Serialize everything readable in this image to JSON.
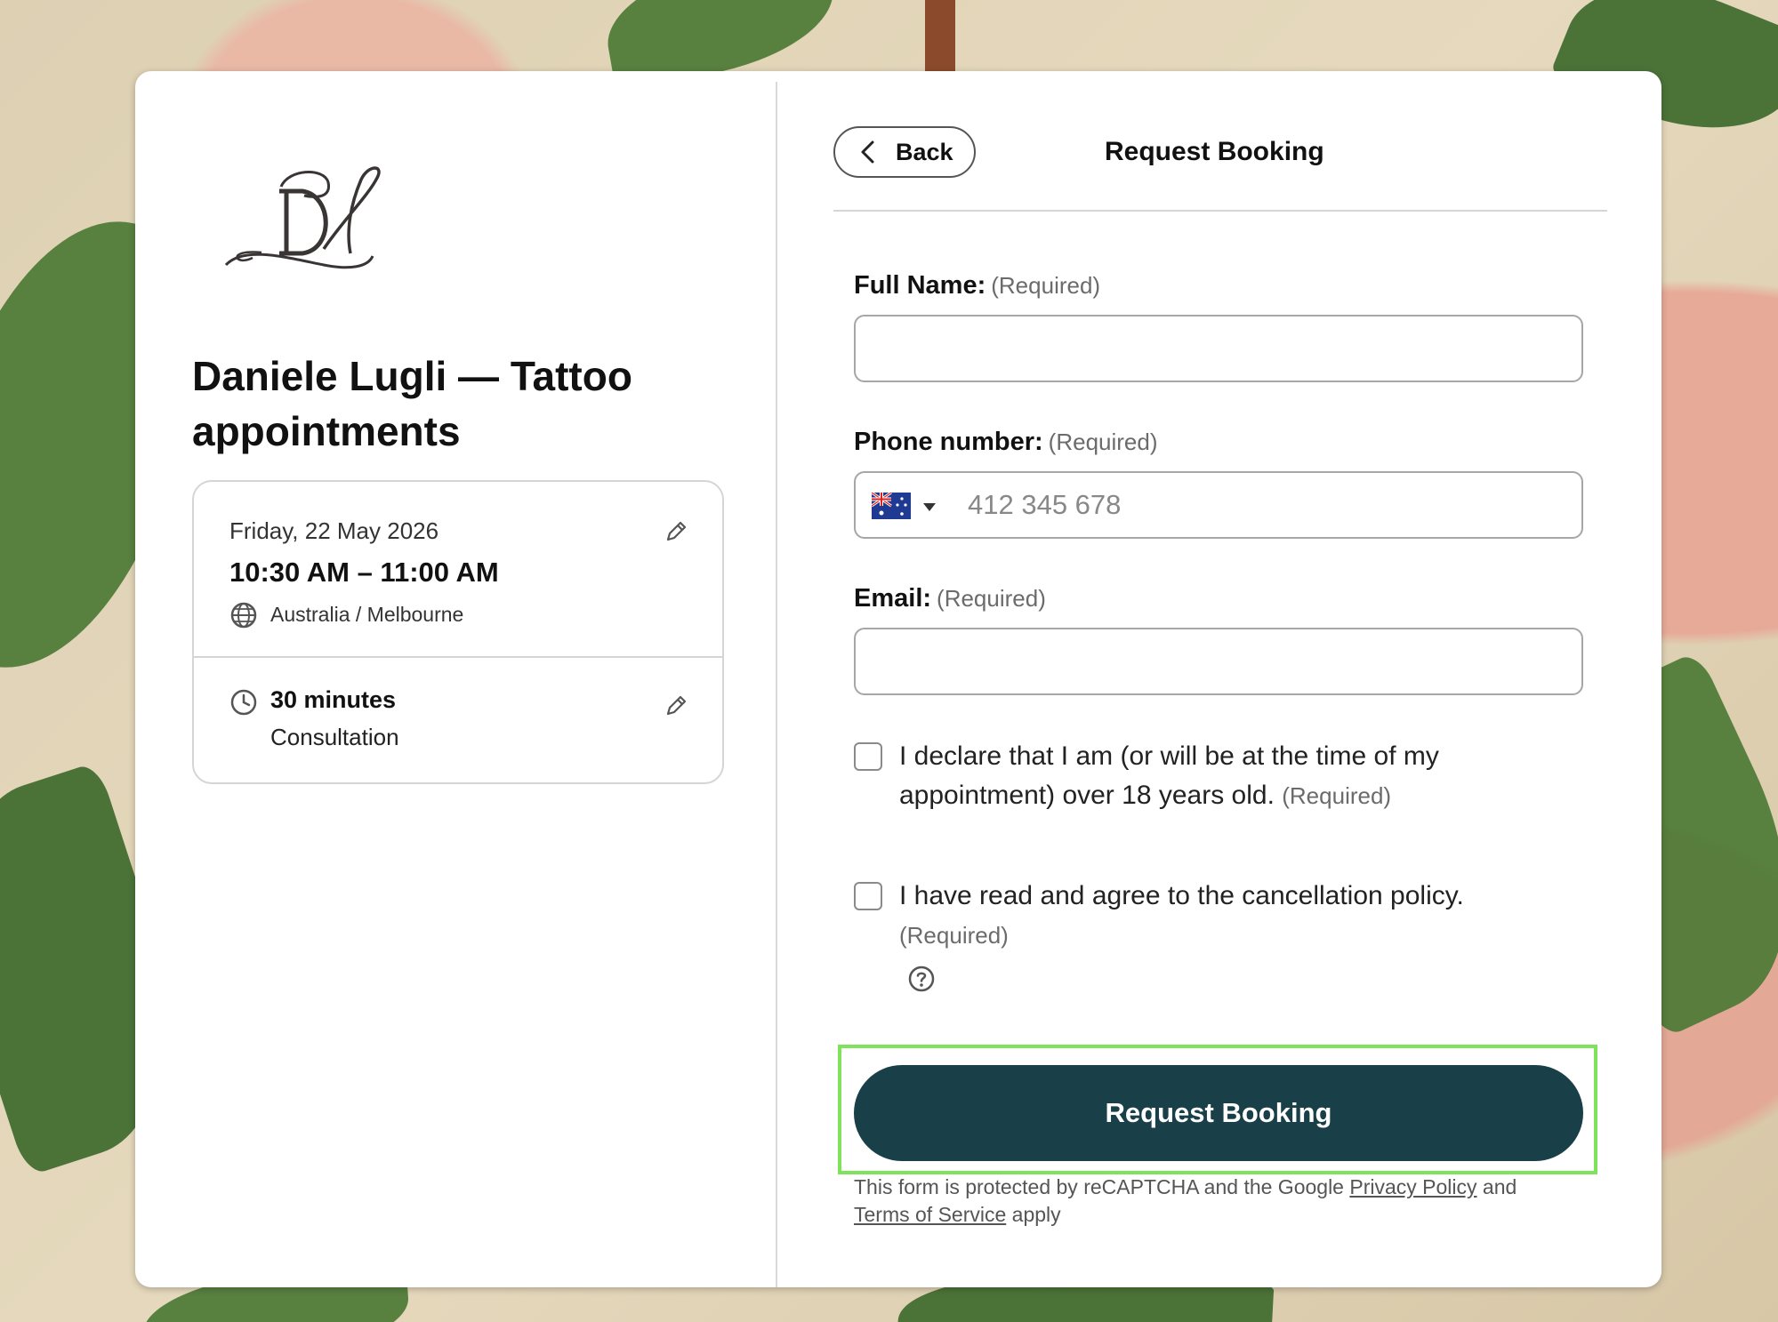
{
  "business": {
    "logo_monogram": "DL",
    "title": "Daniele Lugli — Tattoo appointments"
  },
  "summary": {
    "date": "Friday, 22 May 2026",
    "time_range": "10:30 AM – 11:00 AM",
    "timezone": "Australia / Melbourne",
    "duration": "30 minutes",
    "service": "Consultation"
  },
  "header": {
    "back_label": "Back",
    "title": "Request Booking"
  },
  "form": {
    "full_name_label": "Full Name:",
    "full_name_required": "(Required)",
    "full_name_value": "",
    "phone_label": "Phone number:",
    "phone_required": "(Required)",
    "phone_country": "AU",
    "phone_placeholder": "412 345 678",
    "email_label": "Email:",
    "email_required": "(Required)",
    "email_value": "",
    "age_text_line1": "I declare that I am (or will be at the time of my",
    "age_text_line2": "appointment) over 18 years old.",
    "age_required": "(Required)",
    "age_checked": false,
    "policy_text": "I have read and agree to the cancellation policy.",
    "policy_required": "(Required)",
    "policy_checked": false,
    "submit_label": "Request Booking"
  },
  "legal": {
    "prefix": "This form is protected by reCAPTCHA and the Google",
    "privacy_link": "Privacy Policy",
    "and": "and",
    "terms_link": "Terms of Service",
    "suffix": "apply"
  },
  "icons": {
    "edit": "pencil-icon",
    "timezone": "globe-icon",
    "duration": "clock-icon",
    "back": "chevron-left-icon",
    "help": "question-circle-icon"
  },
  "colors": {
    "primary_button": "#193f48",
    "focus_ring": "#7ee25a"
  }
}
